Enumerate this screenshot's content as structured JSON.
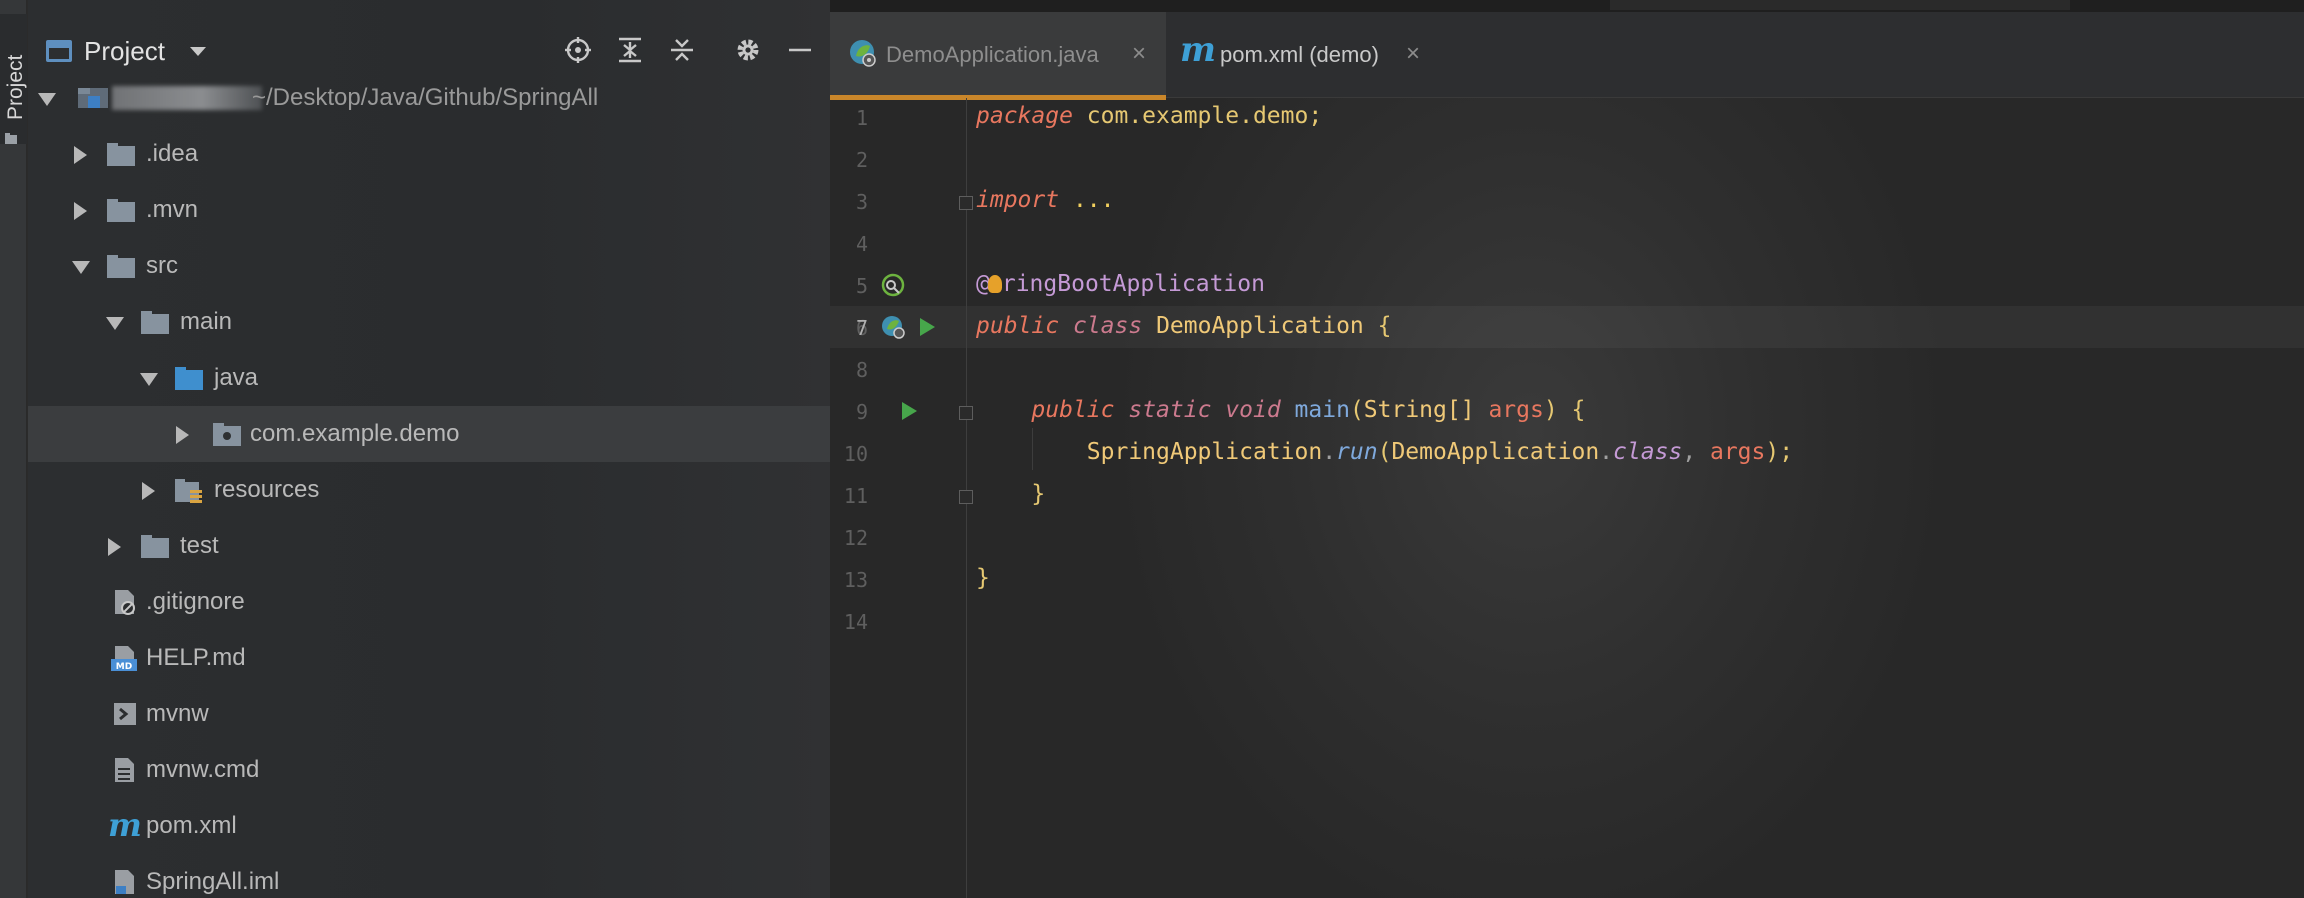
{
  "tool_window_strip": {
    "project_tab_label": "Project"
  },
  "project_panel": {
    "title": "Project",
    "header_buttons": [
      "locate-icon",
      "expand-all-icon",
      "collapse-all-icon",
      "gear-icon",
      "hide-icon"
    ],
    "root": {
      "name_redacted": "SpringAll",
      "path": "~/Desktop/Java/Github/SpringAll"
    },
    "tree": [
      {
        "label": ".idea",
        "icon": "folder-icon",
        "depth": 1,
        "state": "collapsed"
      },
      {
        "label": ".mvn",
        "icon": "folder-icon",
        "depth": 1,
        "state": "collapsed"
      },
      {
        "label": "src",
        "icon": "folder-icon",
        "depth": 1,
        "state": "expanded"
      },
      {
        "label": "main",
        "icon": "folder-icon",
        "depth": 2,
        "state": "expanded"
      },
      {
        "label": "java",
        "icon": "source-folder-icon",
        "depth": 3,
        "state": "expanded"
      },
      {
        "label": "com.example.demo",
        "icon": "package-icon",
        "depth": 4,
        "state": "collapsed",
        "selected": true
      },
      {
        "label": "resources",
        "icon": "resources-folder-icon",
        "depth": 3,
        "state": "collapsed"
      },
      {
        "label": "test",
        "icon": "folder-icon",
        "depth": 2,
        "state": "collapsed"
      },
      {
        "label": ".gitignore",
        "icon": "gitignore-file-icon",
        "depth": 1
      },
      {
        "label": "HELP.md",
        "icon": "markdown-file-icon",
        "depth": 1
      },
      {
        "label": "mvnw",
        "icon": "shell-file-icon",
        "depth": 1
      },
      {
        "label": "mvnw.cmd",
        "icon": "text-file-icon",
        "depth": 1
      },
      {
        "label": "pom.xml",
        "icon": "maven-icon",
        "depth": 1
      },
      {
        "label": "SpringAll.iml",
        "icon": "iml-file-icon",
        "depth": 1
      }
    ]
  },
  "editor": {
    "tabs": [
      {
        "label": "DemoApplication.java",
        "icon": "spring-boot-class-icon",
        "active": true,
        "close": "×"
      },
      {
        "label": "pom.xml (demo)",
        "icon": "maven-icon",
        "active": false,
        "close": "×"
      }
    ],
    "line_numbers": [
      "1",
      "2",
      "3",
      "4",
      "5",
      "6",
      "7",
      "8",
      "9",
      "10",
      "11",
      "12",
      "13",
      "14"
    ],
    "current_line": "7",
    "code": {
      "l1": {
        "kw": "package",
        "rest": " com.example.demo;"
      },
      "l3": {
        "kw": "import",
        "rest": " ..."
      },
      "l6": {
        "at": "@",
        "text": "ringBootApplication"
      },
      "l7": {
        "kw1": "public",
        "kw2": "class",
        "name": "DemoApplication",
        "brace": " {"
      },
      "l9": {
        "kw1": "public",
        "kw2": "static",
        "kw3": "void",
        "fn": "main",
        "open": "(",
        "type": "String[]",
        "param": "args",
        "close": ") {"
      },
      "l10": {
        "cls": "SpringApplication",
        "dot": ".",
        "fn": "run",
        "open": "(",
        "arg1": "DemoApplication",
        "dot2": ".",
        "kw": "class",
        "comma": ", ",
        "arg2": "args",
        "close": ");"
      },
      "l11": {
        "brace": "}"
      },
      "l13": {
        "brace": "}"
      }
    }
  },
  "colors": {
    "accent_tab": "#c9862a",
    "run_green": "#47a64b",
    "keyword": "#e8775f",
    "annotation": "#c59ad6",
    "folder_blue": "#5e8fbf"
  }
}
